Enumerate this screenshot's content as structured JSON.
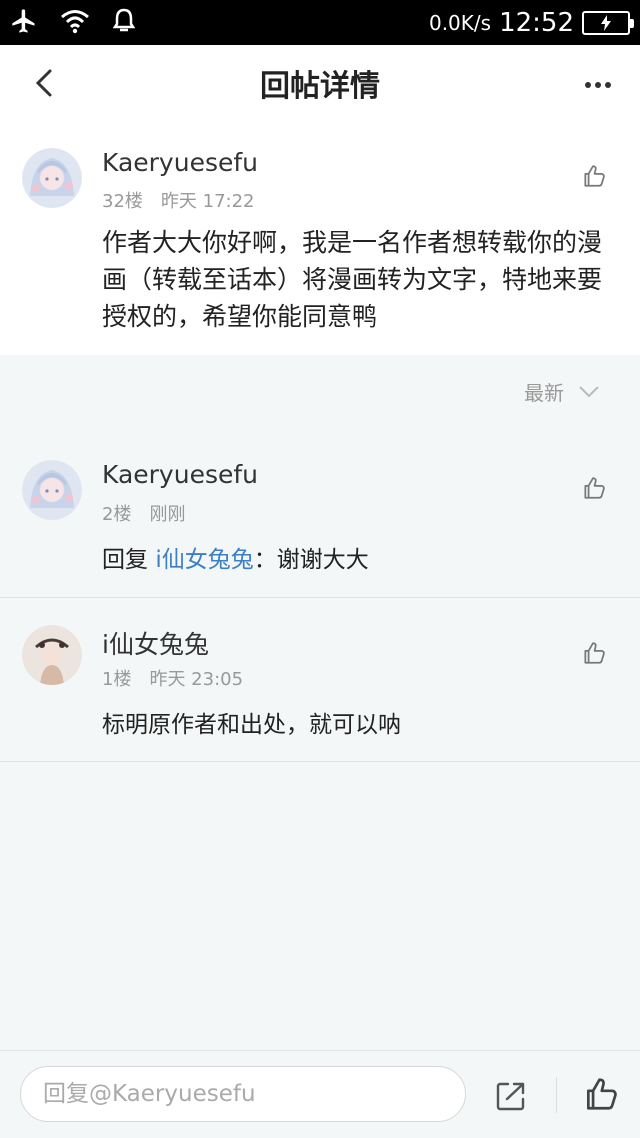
{
  "status_bar": {
    "speed": "0.0K/s",
    "time": "12:52",
    "icons": [
      "airplane-icon",
      "wifi-icon",
      "notification-icon",
      "battery-charging-icon"
    ]
  },
  "header": {
    "title": "回帖详情",
    "icons": [
      "back-arrow-icon",
      "more-icon"
    ]
  },
  "main_post": {
    "author": "Kaeryuesefu",
    "floor": "32楼",
    "time": "昨天 17:22",
    "content": "作者大大你好啊，我是一名作者想转载你的漫画（转载至话本）将漫画转为文字，特地来要授权的，希望你能同意鸭"
  },
  "sort": {
    "label": "最新"
  },
  "replies": [
    {
      "author": "Kaeryuesefu",
      "floor": "2楼",
      "time": "刚刚",
      "reply_prefix": "回复 ",
      "mention": "i仙女兔兔",
      "content": "：谢谢大大"
    },
    {
      "author": "i仙女兔兔",
      "floor": "1楼",
      "time": "昨天 23:05",
      "content": "标明原作者和出处，就可以呐"
    }
  ],
  "bottom_bar": {
    "reply_placeholder": "回复@Kaeryuesefu"
  },
  "colors": {
    "accent_link": "#3d7fc4",
    "background": "#f4f7f7"
  }
}
